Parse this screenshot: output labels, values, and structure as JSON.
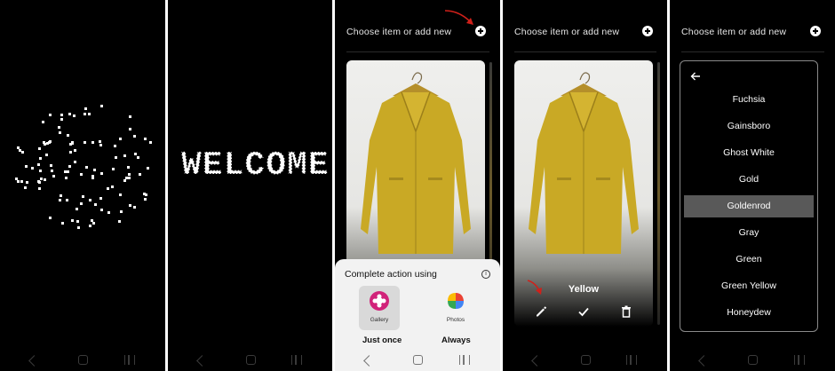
{
  "screens": {
    "welcome": {
      "text": "WELCOME"
    },
    "chooser": {
      "title": "Choose item or add new",
      "sheet": {
        "title": "Complete action using",
        "apps": [
          {
            "label": "Gallery",
            "icon": "gallery-icon",
            "selected": true
          },
          {
            "label": "Photos",
            "icon": "photos-icon",
            "selected": false
          }
        ],
        "just_once": "Just once",
        "always": "Always"
      }
    },
    "item_view": {
      "title": "Choose item or add new",
      "color_name": "Yellow",
      "actions": [
        "edit-icon",
        "check-icon",
        "delete-icon"
      ]
    },
    "color_list": {
      "title": "Choose item or add new",
      "items": [
        "Fuchsia",
        "Gainsboro",
        "Ghost White",
        "Gold",
        "Goldenrod",
        "Gray",
        "Green",
        "Green Yellow",
        "Honeydew"
      ],
      "selected": "Goldenrod"
    }
  },
  "colors": {
    "highlight": "#595959",
    "annotation_arrow": "#d0201a",
    "coat": "#c9a925"
  }
}
